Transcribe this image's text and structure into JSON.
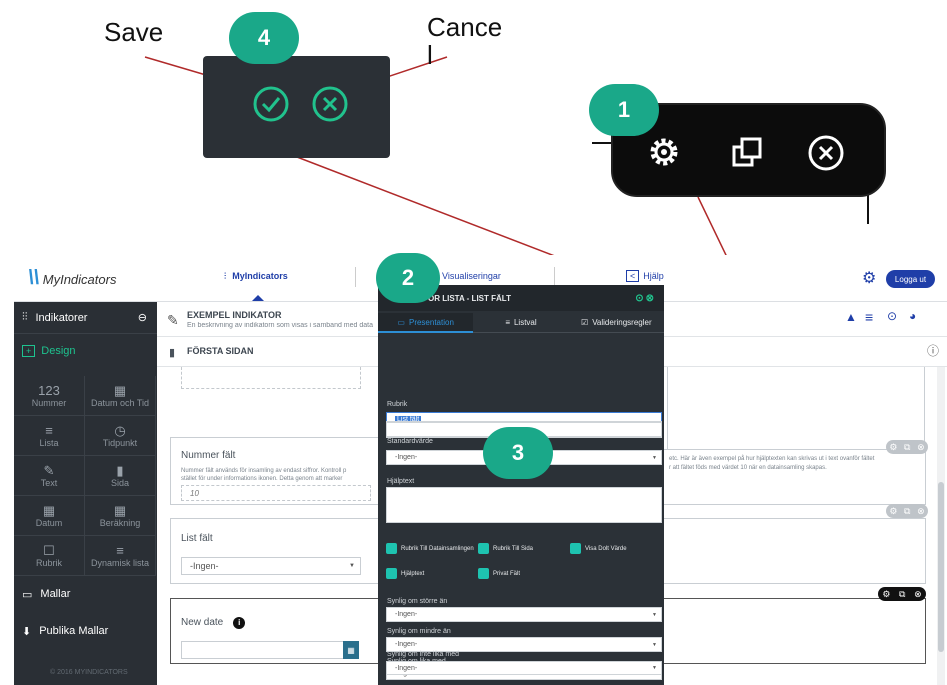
{
  "callouts": {
    "save": "Save",
    "cancel": "Cance\nl",
    "badges": [
      "4",
      "1",
      "2",
      "3"
    ]
  },
  "colors": {
    "accent": "#1aa889",
    "sidebar": "#2a2f35",
    "modal": "#2b3137",
    "primary_button": "#1f3ea8"
  },
  "topbar": {
    "logo": "MyIndicators",
    "nav": [
      "MyIndicators",
      "Visualiseringar",
      "Hjälp"
    ],
    "login": "Logga ut"
  },
  "sidebar": {
    "header": "Indikatorer",
    "design": "Design",
    "tiles": [
      {
        "icon": "123",
        "label": "Nummer"
      },
      {
        "icon": "calendar-icon",
        "label": "Datum och Tid"
      },
      {
        "icon": "list-icon",
        "label": "Lista"
      },
      {
        "icon": "clock-icon",
        "label": "Tidpunkt"
      },
      {
        "icon": "text-icon",
        "label": "Text"
      },
      {
        "icon": "page-icon",
        "label": "Sida"
      },
      {
        "icon": "calendar-icon",
        "label": "Datum"
      },
      {
        "icon": "grid-icon",
        "label": "Beräkning"
      },
      {
        "icon": "heading-icon",
        "label": "Rubrik"
      },
      {
        "icon": "dynamic-list-icon",
        "label": "Dynamisk lista"
      }
    ],
    "templates": "Mallar",
    "public_templates": "Publika Mallar",
    "footer": "© 2016 MYINDICATORS"
  },
  "main": {
    "indicator_title": "EXEMPEL INDIKATOR",
    "indicator_desc": "En beskrivning av indikatorn som visas i samband med data",
    "page_title": "FÖRSTA SIDAN",
    "number_field": {
      "title": "Nummer fält",
      "help_left": "Nummer fält används för insamling av endast siffror. Kontroll p",
      "help_left2": "stället för under informations ikonen. Detta genom att marker",
      "help_right": "etc. Här är även exempel på hur hjälptexten kan skrivas ut i text ovanför fältet",
      "help_right2": "r att fältet föds med värdet 10 när en datainsamling skapas.",
      "value": "10"
    },
    "list_field": {
      "title": "List fält",
      "value": "-Ingen-"
    },
    "date_field": {
      "title": "New date"
    }
  },
  "modal": {
    "title": "OR LISTA - LIST FÄLT",
    "tabs": [
      "Presentation",
      "Listval",
      "Valideringsregler"
    ],
    "rubrik_label": "Rubrik",
    "rubrik_value": "List fält",
    "standard_label": "Standardvärde",
    "standard_value": "-Ingen-",
    "help_label": "Hjälptext",
    "checks": [
      "Rubrik Till Datainsamlingen",
      "Rubrik Till Sida",
      "Visa Dolt Värde",
      "Hjälptext",
      "Privat Fält"
    ],
    "rules": [
      {
        "label": "Synlig om större än",
        "value": "-Ingen-"
      },
      {
        "label": "Synlig om mindre än",
        "value": "-Ingen-"
      },
      {
        "label": "Synlig om lika med",
        "value": "-Ingen-"
      },
      {
        "label": "Synlig om inte lika med",
        "value": "-Ingen-"
      }
    ]
  }
}
